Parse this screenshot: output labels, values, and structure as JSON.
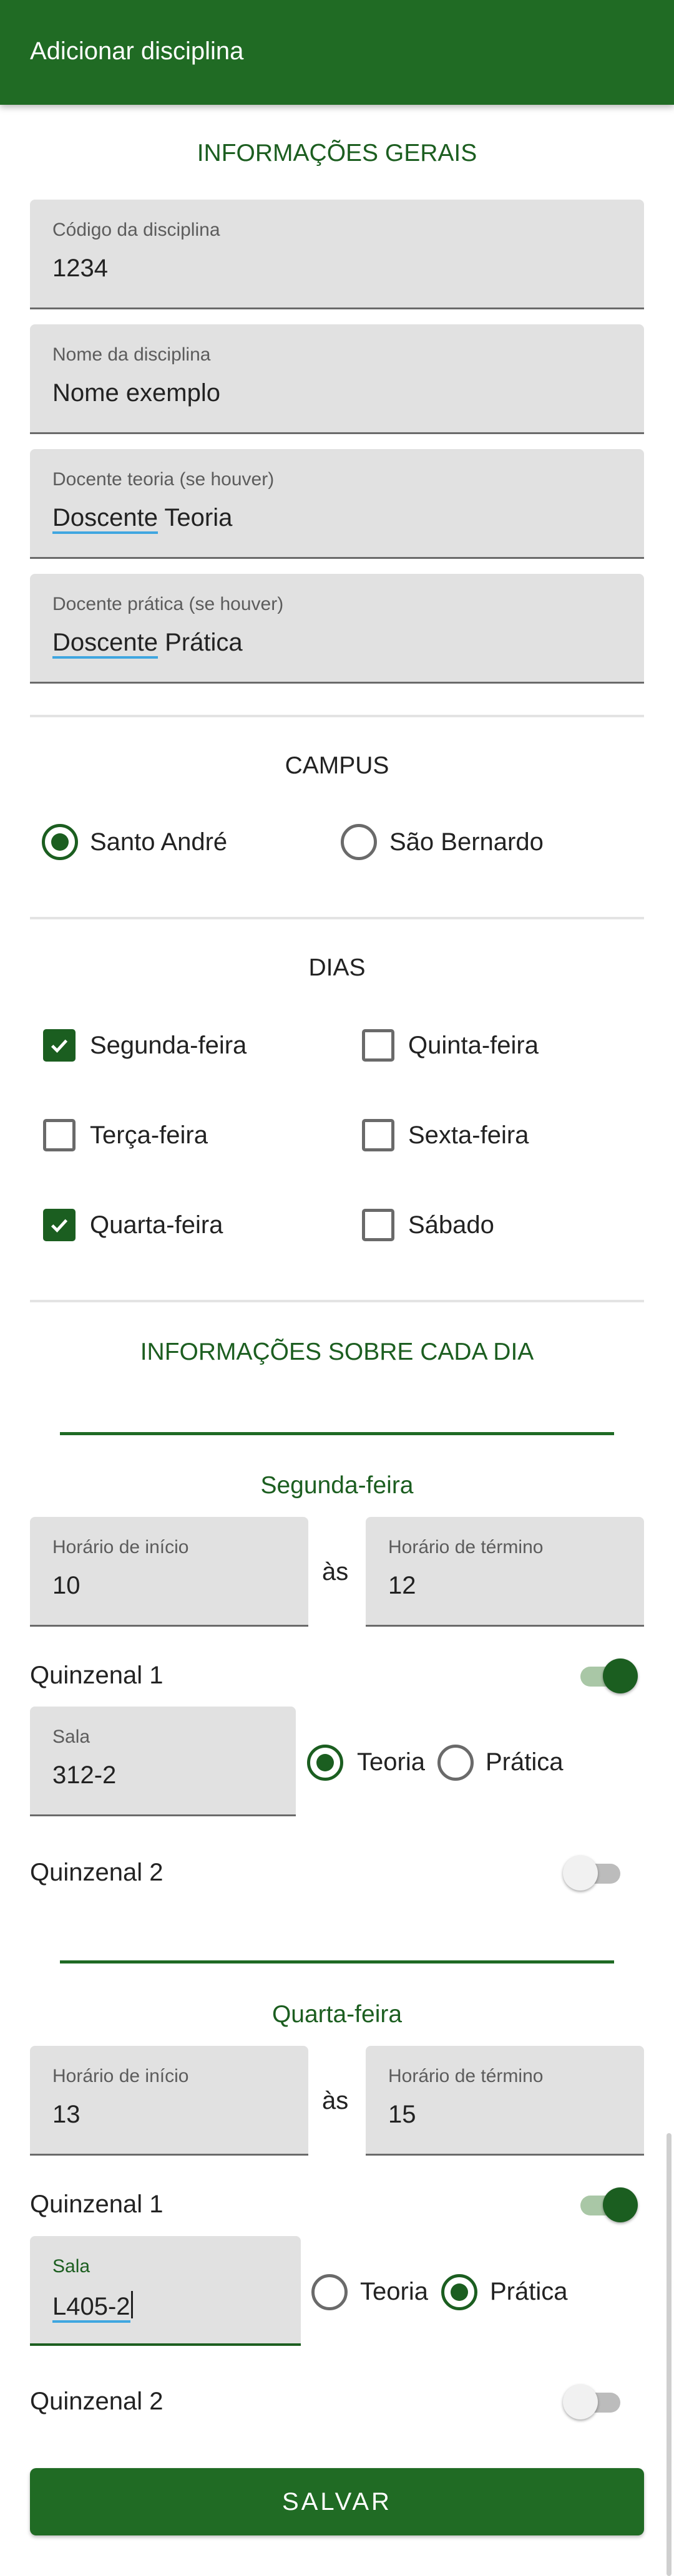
{
  "app_bar": {
    "title": "Adicionar disciplina"
  },
  "general": {
    "title": "INFORMAÇÕES GERAIS",
    "fields": [
      {
        "label": "Código da disciplina",
        "value": "1234"
      },
      {
        "label": "Nome da disciplina",
        "value": "Nome exemplo"
      },
      {
        "label": "Docente teoria (se houver)",
        "value_flagged": "Doscente",
        "value_rest": " Teoria"
      },
      {
        "label": "Docente prática (se houver)",
        "value_flagged": "Doscente",
        "value_rest": " Prática"
      }
    ]
  },
  "campus": {
    "title": "CAMPUS",
    "options": [
      "Santo André",
      "São Bernardo"
    ],
    "selected": "Santo André"
  },
  "days": {
    "title": "DIAS",
    "options": [
      {
        "label": "Segunda-feira",
        "checked": true
      },
      {
        "label": "Quinta-feira",
        "checked": false
      },
      {
        "label": "Terça-feira",
        "checked": false
      },
      {
        "label": "Sexta-feira",
        "checked": false
      },
      {
        "label": "Quarta-feira",
        "checked": true
      },
      {
        "label": "Sábado",
        "checked": false
      }
    ]
  },
  "day_info": {
    "title": "INFORMAÇÕES SOBRE CADA DIA",
    "days": [
      {
        "name": "Segunda-feira",
        "start_label": "Horário de início",
        "start_value": "10",
        "separator": "às",
        "end_label": "Horário de término",
        "end_value": "12",
        "q1_label": "Quinzenal 1",
        "q1_on": true,
        "room_label": "Sala",
        "room_value": "312-2",
        "type_options": [
          "Teoria",
          "Prática"
        ],
        "type_selected": "Teoria",
        "q2_label": "Quinzenal 2",
        "q2_on": false
      },
      {
        "name": "Quarta-feira",
        "start_label": "Horário de início",
        "start_value": "13",
        "separator": "às",
        "end_label": "Horário de término",
        "end_value": "15",
        "q1_label": "Quinzenal 1",
        "q1_on": true,
        "room_label": "Sala",
        "room_value": "L405-2",
        "type_options": [
          "Teoria",
          "Prática"
        ],
        "type_selected": "Prática",
        "q2_label": "Quinzenal 2",
        "q2_on": false
      }
    ]
  },
  "save_button": {
    "label": "SALVAR"
  },
  "colors": {
    "primary": "#206b24",
    "accent_dark": "#1b5e20",
    "field_bg": "#e1e1e1",
    "spell_underline": "#3fa6e0"
  },
  "icons": [
    "check-icon"
  ]
}
